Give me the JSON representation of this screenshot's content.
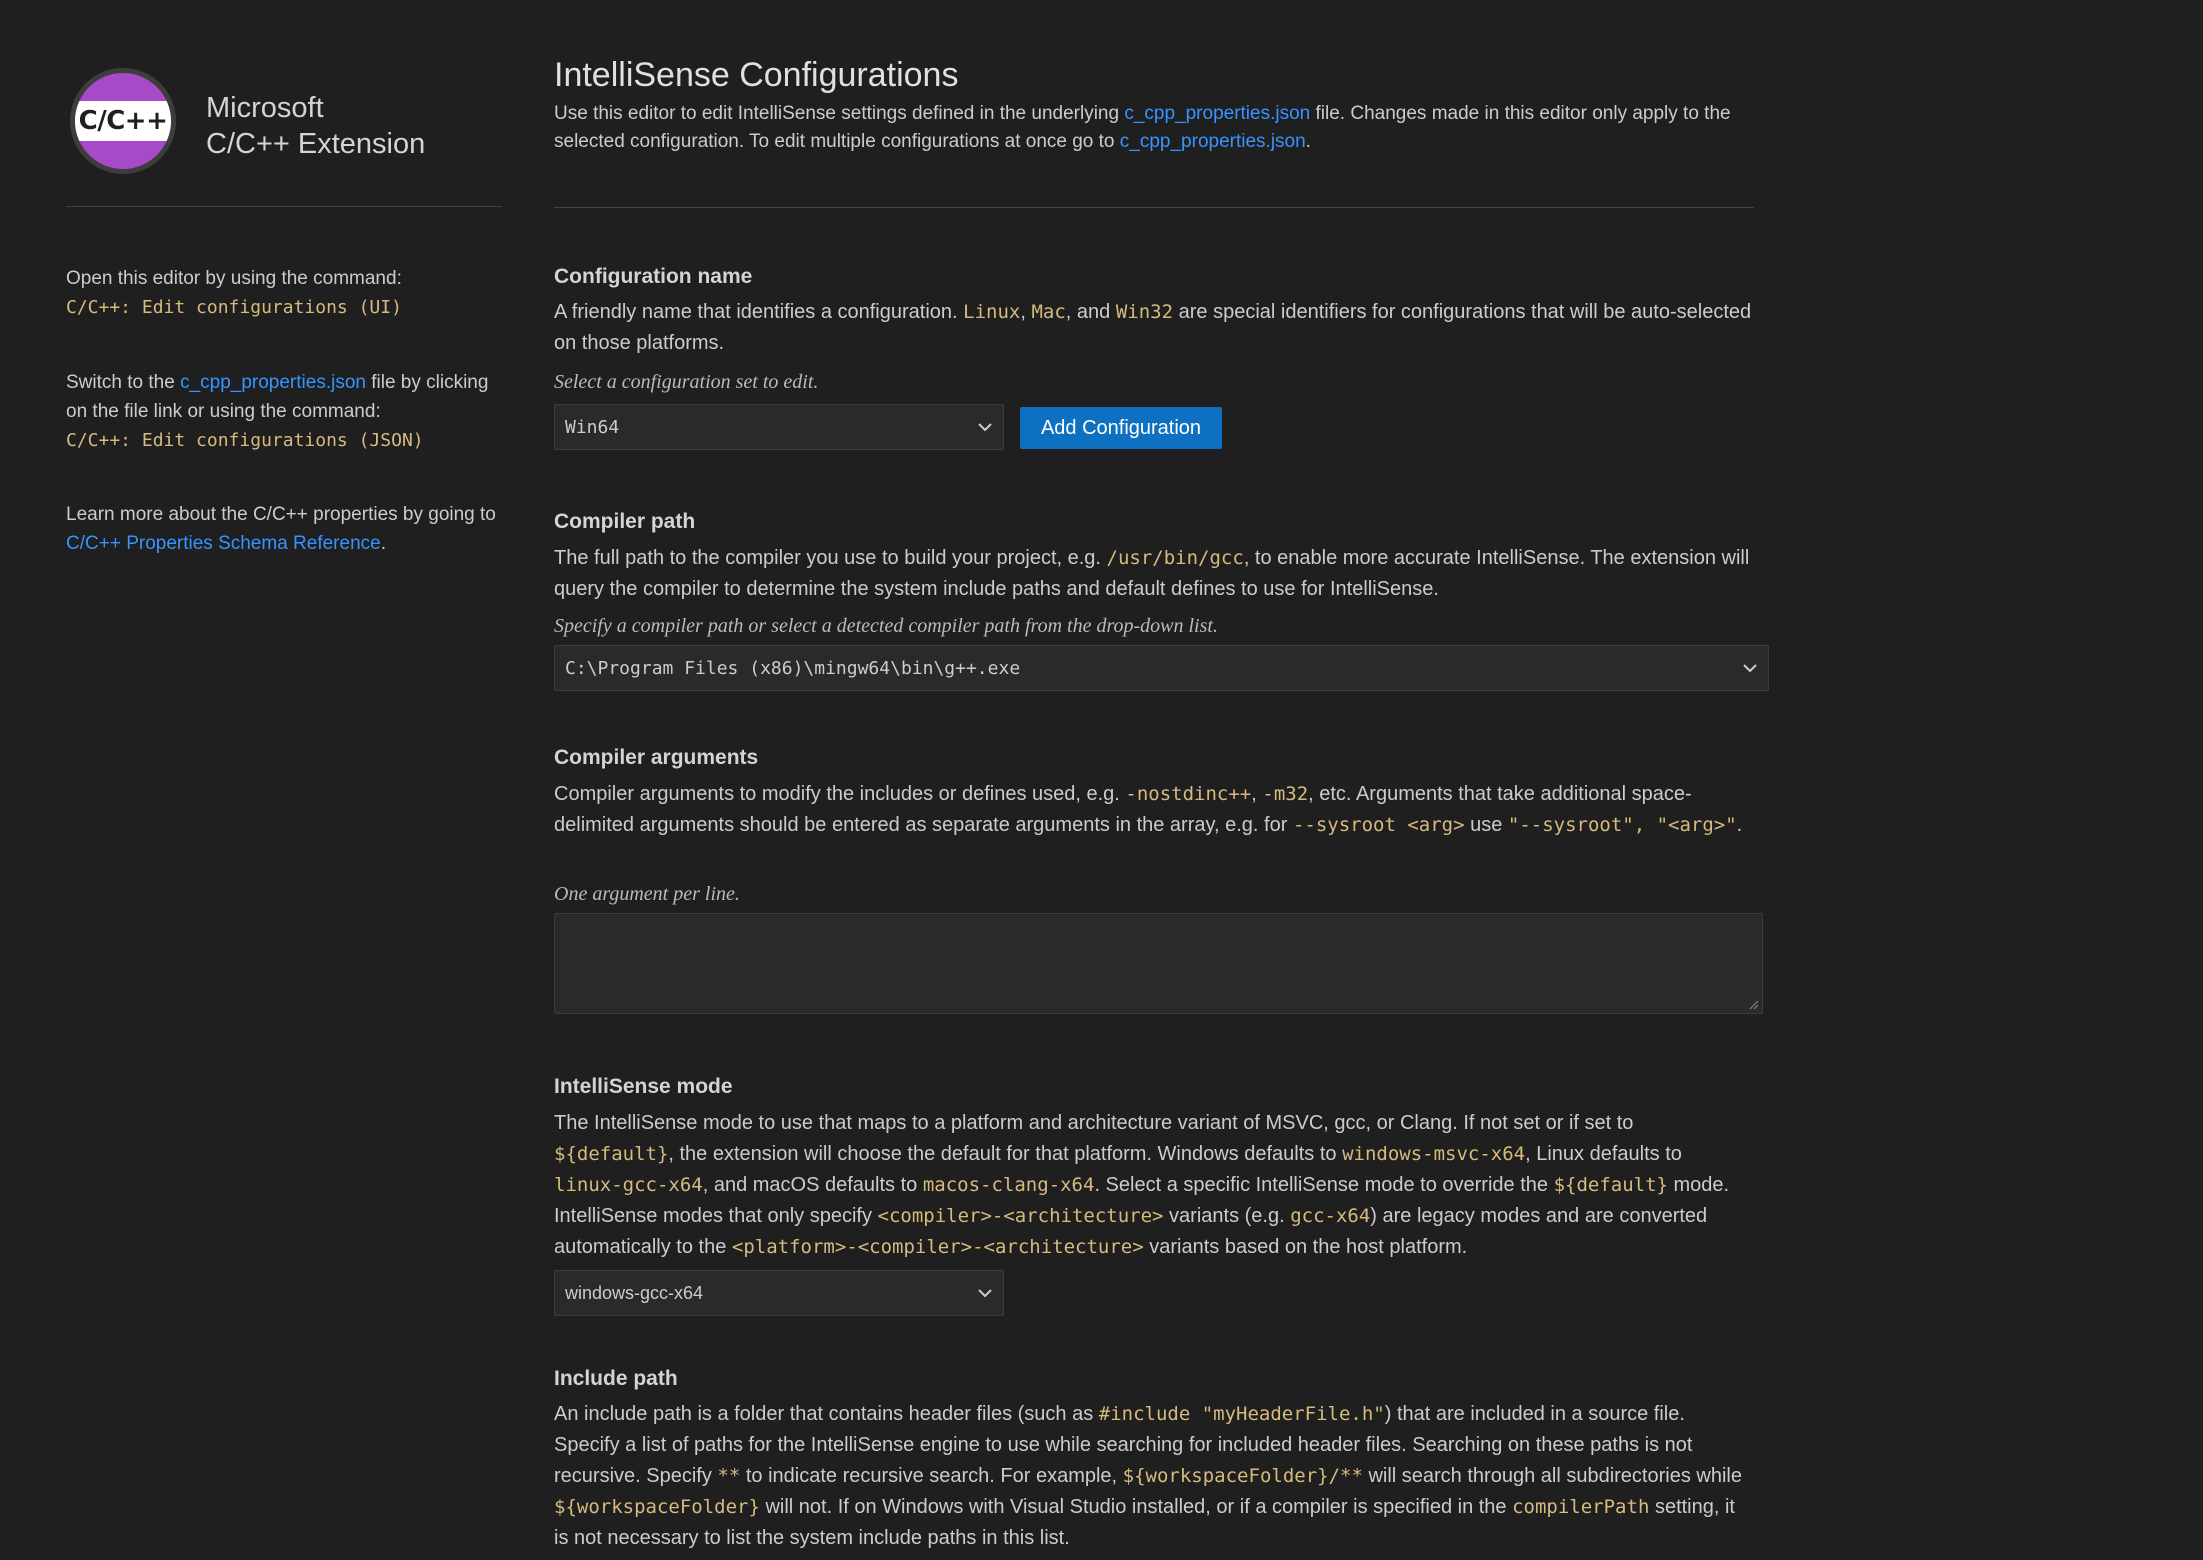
{
  "sidebar": {
    "logo_text": "C/C++",
    "brand_line1": "Microsoft",
    "brand_line2": "C/C++ Extension",
    "open_text": "Open this editor by using the command:",
    "open_command": "C/C++: Edit configurations (UI)",
    "switch_prefix": "Switch to the ",
    "switch_link": "c_cpp_properties.json",
    "switch_suffix": " file by clicking on the file link or using the command:",
    "switch_command": "C/C++: Edit configurations (JSON)",
    "learn_prefix": "Learn more about the C/C++ properties by going to ",
    "learn_link": "C/C++ Properties Schema Reference",
    "learn_suffix": "."
  },
  "header": {
    "title": "IntelliSense Configurations",
    "desc_1": "Use this editor to edit IntelliSense settings defined in the underlying ",
    "desc_link1": "c_cpp_properties.json",
    "desc_2": " file. Changes made in this editor only apply to the selected configuration. To edit multiple configurations at once go to ",
    "desc_link2": "c_cpp_properties.json",
    "desc_3": "."
  },
  "config_name": {
    "title": "Configuration name",
    "d1": "A friendly name that identifies a configuration. ",
    "c1": "Linux",
    "d2": ", ",
    "c2": "Mac",
    "d3": ", and ",
    "c3": "Win32",
    "d4": " are special identifiers for configurations that will be auto-selected on those platforms.",
    "hint": "Select a configuration set to edit.",
    "selected": "Win64",
    "add_button": "Add Configuration"
  },
  "compiler_path": {
    "title": "Compiler path",
    "d1": "The full path to the compiler you use to build your project, e.g. ",
    "c1": "/usr/bin/gcc",
    "d2": ", to enable more accurate IntelliSense. The extension will query the compiler to determine the system include paths and default defines to use for IntelliSense.",
    "hint": "Specify a compiler path or select a detected compiler path from the drop-down list.",
    "value": "C:\\Program Files (x86)\\mingw64\\bin\\g++.exe"
  },
  "compiler_args": {
    "title": "Compiler arguments",
    "d1": "Compiler arguments to modify the includes or defines used, e.g. ",
    "c1": "-nostdinc++",
    "d2": ", ",
    "c2": "-m32",
    "d3": ", etc. Arguments that take additional space-delimited arguments should be entered as separate arguments in the array, e.g. for ",
    "c3": "--sysroot <arg>",
    "d4": " use ",
    "c4": "\"--sysroot\", \"<arg>\"",
    "d5": ".",
    "hint": "One argument per line."
  },
  "intellisense_mode": {
    "title": "IntelliSense mode",
    "d1": "The IntelliSense mode to use that maps to a platform and architecture variant of MSVC, gcc, or Clang. If not set or if set to ",
    "c1": "${default}",
    "d2": ", the extension will choose the default for that platform. Windows defaults to ",
    "c2": "windows-msvc-x64",
    "d3": ", Linux defaults to ",
    "c3": "linux-gcc-x64",
    "d4": ", and macOS defaults to ",
    "c4": "macos-clang-x64",
    "d5": ". Select a specific IntelliSense mode to override the ",
    "c5": "${default}",
    "d6": " mode. IntelliSense modes that only specify ",
    "c6": "<compiler>-<architecture>",
    "d7": " variants (e.g. ",
    "c7": "gcc-x64",
    "d8": ") are legacy modes and are converted automatically to the ",
    "c8": "<platform>-<compiler>-<architecture>",
    "d9": " variants based on the host platform.",
    "selected": "windows-gcc-x64"
  },
  "include_path": {
    "title": "Include path",
    "d1": "An include path is a folder that contains header files (such as ",
    "c1": "#include \"myHeaderFile.h\"",
    "d2": ") that are included in a source file. Specify a list of paths for the IntelliSense engine to use while searching for included header files. Searching on these paths is not recursive. Specify ",
    "c2": "**",
    "d3": " to indicate recursive search. For example, ",
    "c3": "${workspaceFolder}/**",
    "d4": " will search through all subdirectories while ",
    "c4": "${workspaceFolder}",
    "d5": " will not. If on Windows with Visual Studio installed, or if a compiler is specified in the ",
    "c5": "compilerPath",
    "d6": " setting, it is not necessary to list the system include paths in this list."
  }
}
